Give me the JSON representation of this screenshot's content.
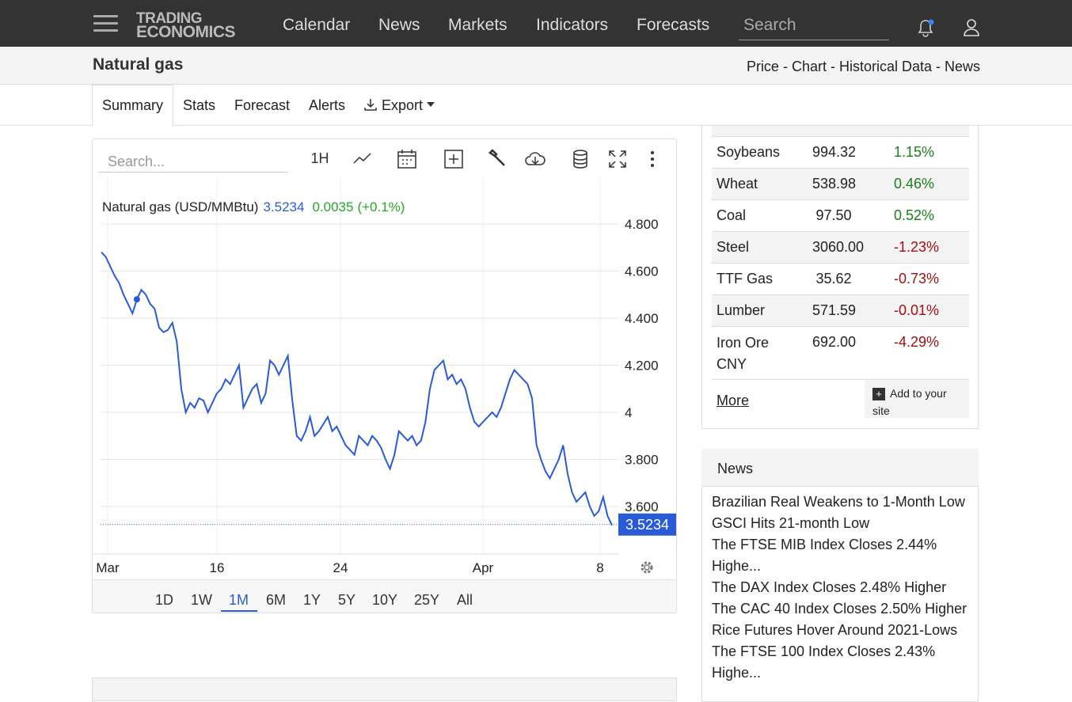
{
  "header": {
    "logo_line1": "TRADING",
    "logo_line2": "ECONOMICS",
    "nav": [
      "Calendar",
      "News",
      "Markets",
      "Indicators",
      "Forecasts"
    ],
    "search_placeholder": "Search"
  },
  "page": {
    "title": "Natural gas",
    "crumbs": "Price - Chart - Historical Data - News"
  },
  "tabs": [
    "Summary",
    "Stats",
    "Forecast",
    "Alerts",
    "Export"
  ],
  "chart_tools": {
    "search_placeholder": "Search...",
    "interval": "1H"
  },
  "chart_data": {
    "type": "line",
    "title": "Natural gas (USD/MMBtu)",
    "last_value": "3.5234",
    "change": "0.0035",
    "change_pct": "(+0.1%)",
    "price_tag": "3.5234",
    "x_ticks": [
      "Mar",
      "16",
      "24",
      "Apr",
      "8"
    ],
    "y_ticks": [
      "4.800",
      "4.600",
      "4.400",
      "4.200",
      "4",
      "3.800",
      "3.600"
    ],
    "ylim": [
      3.45,
      4.85
    ],
    "y": [
      4.68,
      4.66,
      4.62,
      4.58,
      4.55,
      4.5,
      4.46,
      4.42,
      4.48,
      4.52,
      4.5,
      4.46,
      4.44,
      4.36,
      4.34,
      4.35,
      4.38,
      4.3,
      4.1,
      4.0,
      4.04,
      4.02,
      4.06,
      4.05,
      4.0,
      4.04,
      4.08,
      4.1,
      4.14,
      4.12,
      4.16,
      4.2,
      4.02,
      4.06,
      4.1,
      4.12,
      4.04,
      4.08,
      4.22,
      4.2,
      4.16,
      4.2,
      4.24,
      4.05,
      3.9,
      3.88,
      3.92,
      3.98,
      3.9,
      3.92,
      3.95,
      3.98,
      3.92,
      3.94,
      3.9,
      3.86,
      3.84,
      3.82,
      3.9,
      3.88,
      3.86,
      3.9,
      3.88,
      3.85,
      3.8,
      3.76,
      3.82,
      3.92,
      3.9,
      3.88,
      3.9,
      3.86,
      3.88,
      3.96,
      4.1,
      4.18,
      4.2,
      4.22,
      4.14,
      4.16,
      4.12,
      4.14,
      4.1,
      4.02,
      3.96,
      3.94,
      3.96,
      3.98,
      4.0,
      3.98,
      4.02,
      4.08,
      4.14,
      4.18,
      4.16,
      4.14,
      4.12,
      4.06,
      3.86,
      3.8,
      3.75,
      3.72,
      3.76,
      3.8,
      3.86,
      3.74,
      3.66,
      3.62,
      3.64,
      3.66,
      3.6,
      3.56,
      3.58,
      3.64,
      3.56,
      3.52
    ]
  },
  "ranges": [
    "1D",
    "1W",
    "1M",
    "6M",
    "1Y",
    "5Y",
    "10Y",
    "25Y",
    "All"
  ],
  "commodities": [
    {
      "name": "Soybeans",
      "price": "994.32",
      "change": "1.15%",
      "dir": "pos"
    },
    {
      "name": "Wheat",
      "price": "538.98",
      "change": "0.46%",
      "dir": "pos"
    },
    {
      "name": "Coal",
      "price": "97.50",
      "change": "0.52%",
      "dir": "pos"
    },
    {
      "name": "Steel",
      "price": "3060.00",
      "change": "-1.23%",
      "dir": "neg"
    },
    {
      "name": "TTF Gas",
      "price": "35.62",
      "change": "-0.73%",
      "dir": "neg"
    },
    {
      "name": "Lumber",
      "price": "571.59",
      "change": "-0.01%",
      "dir": "neg"
    },
    {
      "name": "Iron Ore CNY",
      "price": "692.00",
      "change": "-4.29%",
      "dir": "neg"
    }
  ],
  "side_more": "More",
  "side_add": "Add to your site",
  "news": {
    "heading": "News",
    "items": [
      "Brazilian Real Weakens to 1-Month Low",
      "GSCI Hits 21-month Low",
      "The FTSE MIB Index Closes 2.44% Highe...",
      "The DAX Index Closes 2.48% Higher",
      "The CAC 40 Index Closes 2.50% Higher",
      "Rice Futures Hover Around 2021-Lows",
      "The FTSE 100 Index Closes 2.43% Highe..."
    ]
  }
}
